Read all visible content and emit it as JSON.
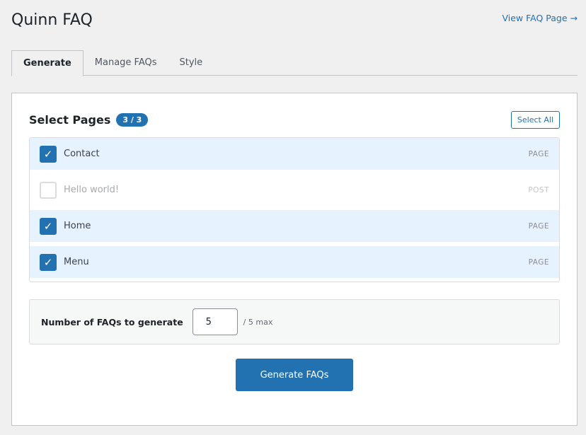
{
  "header": {
    "title": "Quinn FAQ",
    "view_link": "View FAQ Page →"
  },
  "tabs": [
    {
      "label": "Generate",
      "active": true
    },
    {
      "label": "Manage FAQs"
    },
    {
      "label": "Style"
    }
  ],
  "select_pages": {
    "title": "Select Pages",
    "count_badge": "3 / 3",
    "select_all": "Select All",
    "items": [
      {
        "label": "Contact",
        "type": "PAGE",
        "checked": true
      },
      {
        "label": "Hello world!",
        "type": "POST",
        "checked": false
      },
      {
        "label": "Home",
        "type": "PAGE",
        "checked": true
      },
      {
        "label": "Menu",
        "type": "PAGE",
        "checked": true
      }
    ]
  },
  "faq_count": {
    "label": "Number of FAQs to generate",
    "value": "5",
    "max_text": "/ 5 max"
  },
  "generate_button": "Generate FAQs",
  "icons": {
    "check": "✓"
  },
  "colors": {
    "accent": "#2271b1",
    "row_selected": "#e6f2fd"
  }
}
